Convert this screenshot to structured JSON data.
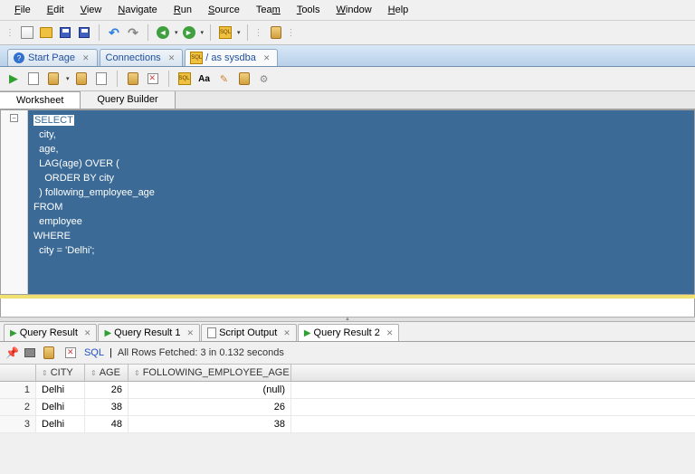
{
  "menu": [
    "File",
    "Edit",
    "View",
    "Navigate",
    "Run",
    "Source",
    "Team",
    "Tools",
    "Window",
    "Help"
  ],
  "tabs": {
    "start": "Start Page",
    "connections": "Connections",
    "sysdba": "/ as sysdba"
  },
  "editor_tabs": {
    "worksheet": "Worksheet",
    "query_builder": "Query Builder"
  },
  "sql": {
    "l1": "SELECT",
    "l2": "  city,",
    "l3": "  age,",
    "l4": "  LAG(age) OVER (",
    "l5": "    ORDER BY city",
    "l6": "  ) following_employee_age",
    "l7": "FROM",
    "l8": "  employee",
    "l9": "WHERE",
    "l10": "  city = 'Delhi';"
  },
  "result_tabs": {
    "qr": "Query Result",
    "qr1": "Query Result 1",
    "so": "Script Output",
    "qr2": "Query Result 2"
  },
  "result_toolbar": {
    "sql": "SQL",
    "status": "All Rows Fetched: 3 in 0.132 seconds"
  },
  "columns": {
    "city": "CITY",
    "age": "AGE",
    "fea": "FOLLOWING_EMPLOYEE_AGE"
  },
  "rows": [
    {
      "n": "1",
      "city": "Delhi",
      "age": "26",
      "fea": "(null)"
    },
    {
      "n": "2",
      "city": "Delhi",
      "age": "38",
      "fea": "26"
    },
    {
      "n": "3",
      "city": "Delhi",
      "age": "48",
      "fea": "38"
    }
  ],
  "chart_data": {
    "type": "table",
    "title": "Query Result 2",
    "columns": [
      "CITY",
      "AGE",
      "FOLLOWING_EMPLOYEE_AGE"
    ],
    "data": [
      [
        "Delhi",
        26,
        null
      ],
      [
        "Delhi",
        38,
        26
      ],
      [
        "Delhi",
        48,
        38
      ]
    ]
  }
}
